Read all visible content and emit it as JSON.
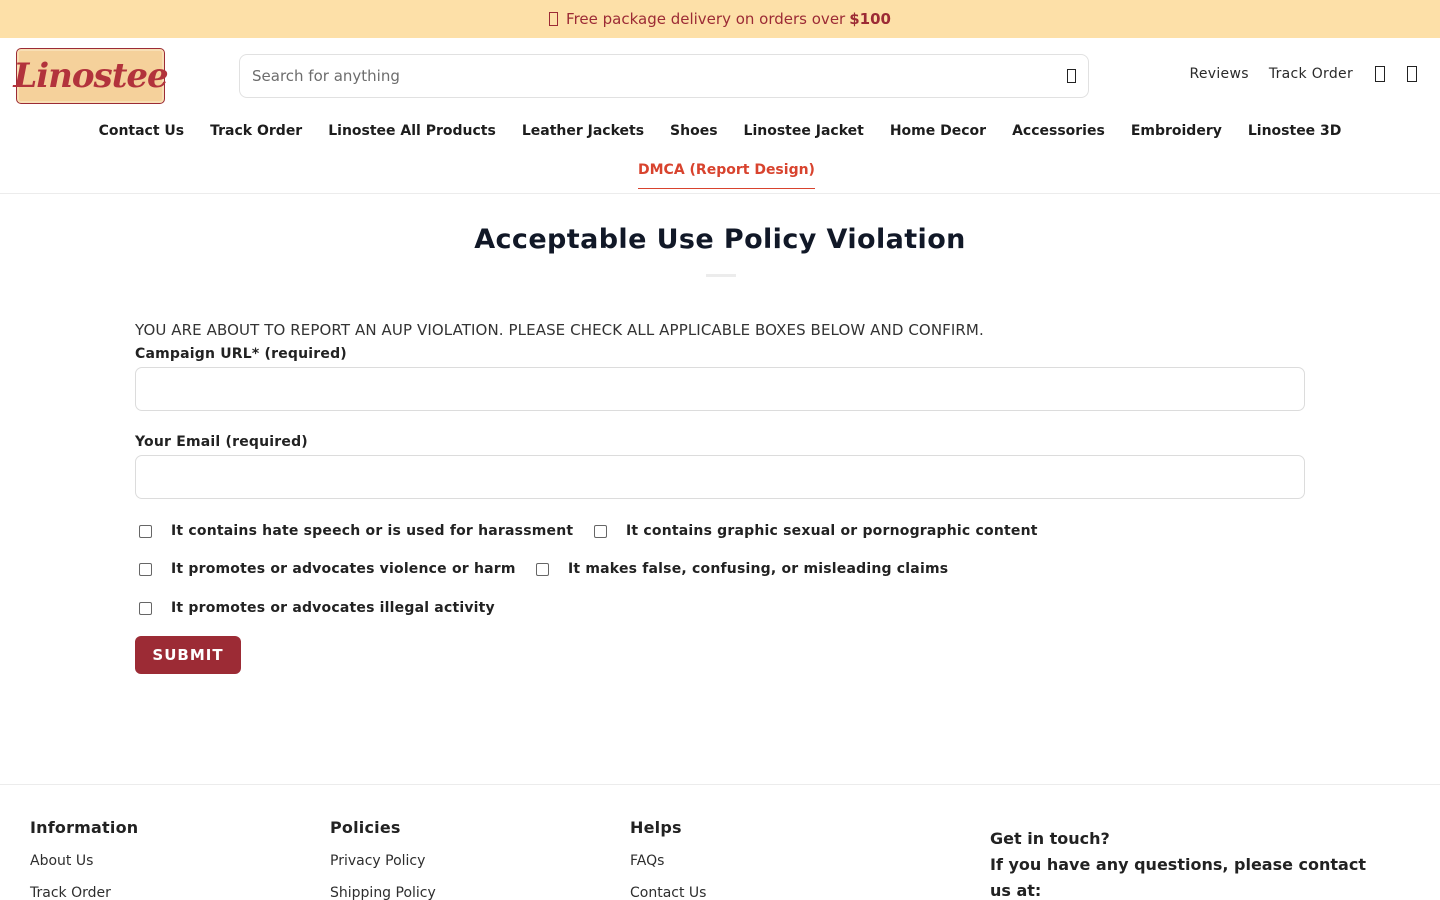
{
  "promo": {
    "icon": "truck-icon",
    "text": "Free package delivery on orders over",
    "amount": "$100"
  },
  "header": {
    "logo_text": "Linostee",
    "search_placeholder": "Search for anything",
    "links": [
      "Reviews",
      "Track Order"
    ]
  },
  "nav": {
    "items": [
      "Contact Us",
      "Track Order",
      "Linostee All Products",
      "Leather Jackets",
      "Shoes",
      "Linostee Jacket",
      "Home Decor",
      "Accessories",
      "Embroidery",
      "Linostee 3D"
    ],
    "active": "DMCA (Report Design)"
  },
  "main": {
    "title": "Acceptable Use Policy Violation",
    "intro": "YOU ARE ABOUT TO REPORT AN AUP VIOLATION. PLEASE CHECK ALL APPLICABLE BOXES BELOW AND CONFIRM.",
    "campaign_label": "Campaign URL* (required)",
    "email_label": "Your Email (required)",
    "checkboxes": [
      "It contains hate speech or is used for harassment",
      "It contains graphic sexual or pornographic content",
      "It promotes or advocates violence or harm",
      "It makes false, confusing, or misleading claims",
      "It promotes or advocates illegal activity"
    ],
    "submit_label": "SUBMIT"
  },
  "footer": {
    "information": {
      "title": "Information",
      "links": [
        "About Us",
        "Track Order"
      ]
    },
    "policies": {
      "title": "Policies",
      "links": [
        "Privacy Policy",
        "Shipping Policy"
      ]
    },
    "helps": {
      "title": "Helps",
      "links": [
        "FAQs",
        "Contact Us"
      ]
    },
    "contact": {
      "title": "Get in touch?",
      "text": "If you have any questions, please contact us at:"
    }
  },
  "colors": {
    "accent": "#9c2b35",
    "promo_bg": "#fde0a8",
    "active_nav": "#d8432e"
  }
}
